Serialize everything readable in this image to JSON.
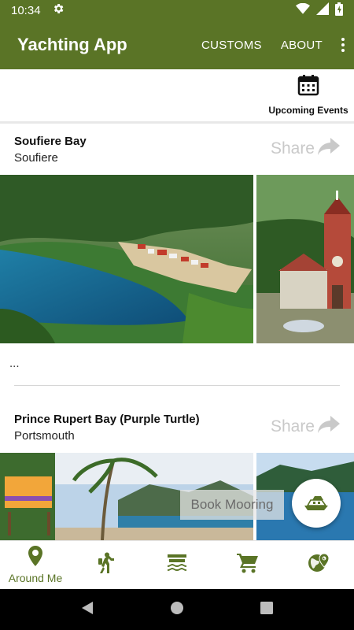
{
  "status_bar": {
    "time": "10:34"
  },
  "app_bar": {
    "title": "Yachting App",
    "actions": [
      "CUSTOMS",
      "ABOUT"
    ]
  },
  "events": {
    "label": "Upcoming Events"
  },
  "cards": [
    {
      "title": "Soufiere Bay",
      "subtitle": "Soufiere",
      "share_label": "Share"
    },
    {
      "title": "Prince Rupert Bay (Purple Turtle)",
      "subtitle": "Portsmouth",
      "share_label": "Share"
    }
  ],
  "ellipsis": "...",
  "book_mooring": "Book Mooring",
  "bottom_nav": {
    "active_label": "Around Me"
  },
  "colors": {
    "brand": "#5a7426",
    "share_gray": "#c9c9c9"
  }
}
